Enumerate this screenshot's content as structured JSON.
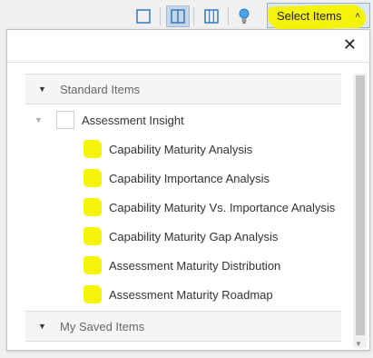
{
  "toolbar": {
    "layouts": [
      {
        "name": "single-pane-icon",
        "active": false
      },
      {
        "name": "two-pane-icon",
        "active": true
      },
      {
        "name": "three-pane-icon",
        "active": false
      }
    ],
    "tip_icon": "lightbulb-icon",
    "select_items_label": "Select Items",
    "select_items_caret": "˄"
  },
  "panel": {
    "close_label": "✕",
    "standard_section_label": "Standard Items",
    "root_item_label": "Assessment Insight",
    "items": [
      "Capability Maturity Analysis",
      "Capability Importance Analysis",
      "Capability Maturity Vs. Importance Analysis",
      "Capability Maturity Gap Analysis",
      "Assessment Maturity Distribution",
      "Assessment Maturity Roadmap"
    ],
    "saved_section_label": "My Saved Items"
  },
  "colors": {
    "highlight": "#f4f40a",
    "active_toolbar": "#c9d6e6",
    "icon_blue": "#2f7bbf"
  }
}
